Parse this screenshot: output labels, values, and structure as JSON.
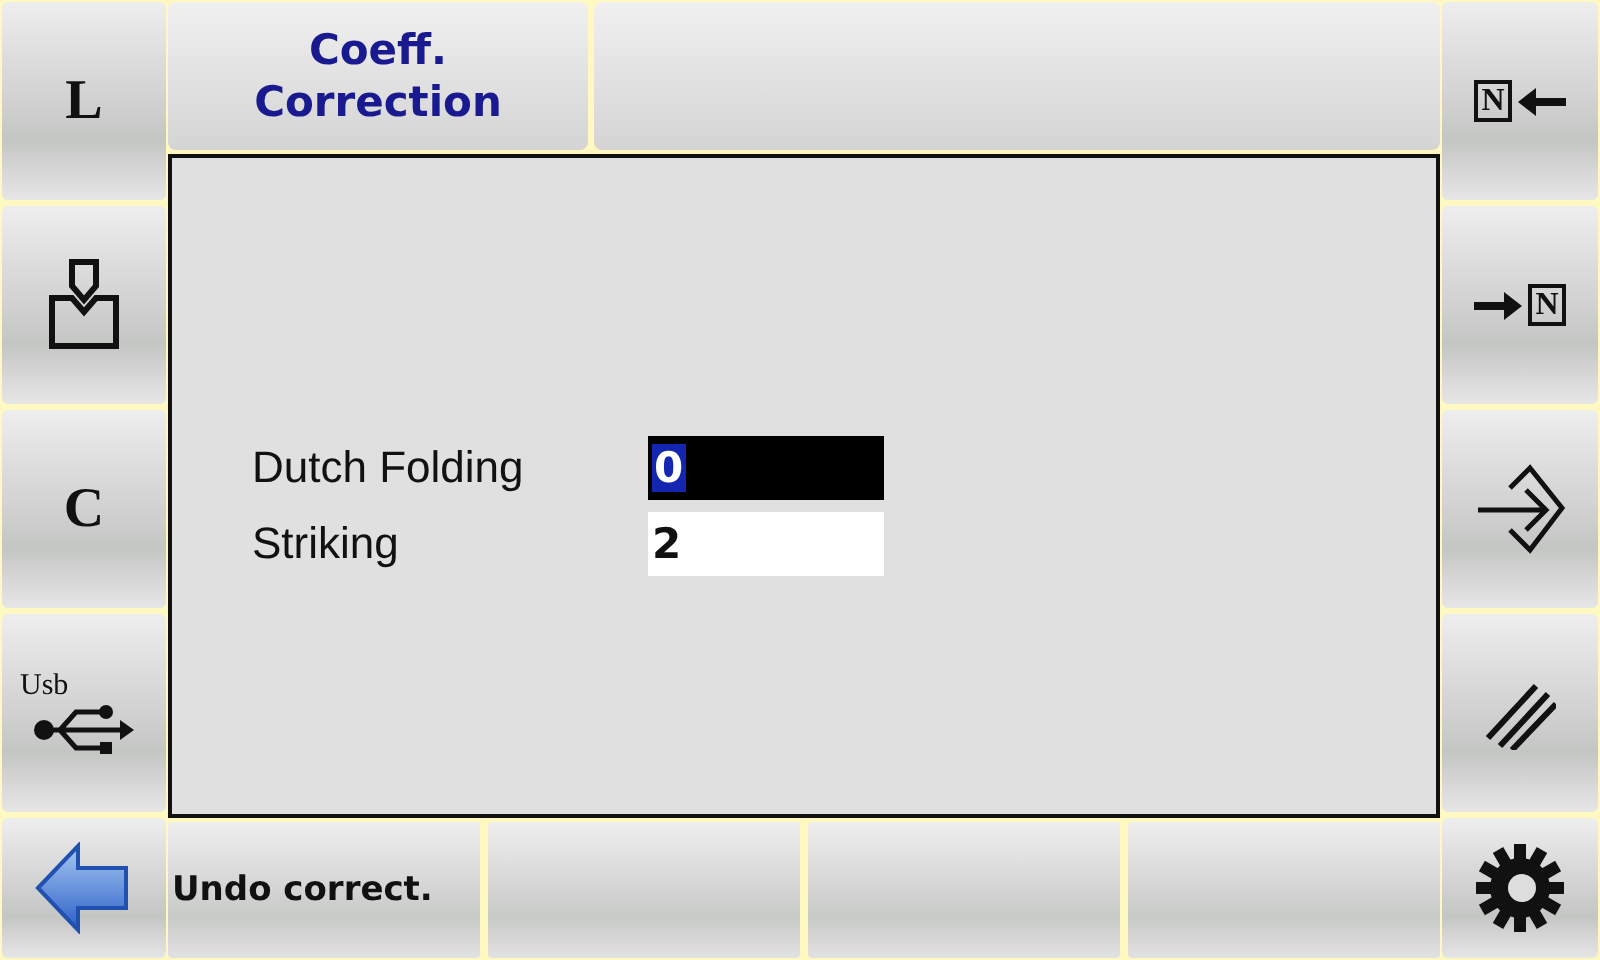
{
  "left_buttons": [
    {
      "kind": "letter",
      "label": "L"
    },
    {
      "kind": "punch"
    },
    {
      "kind": "letter",
      "label": "C"
    },
    {
      "kind": "usb",
      "label": "Usb"
    },
    {
      "kind": "back"
    }
  ],
  "top_tabs": [
    {
      "kind": "labelled",
      "label": "Coeff.\nCorrection"
    },
    {
      "kind": "blank"
    }
  ],
  "fields": [
    {
      "label": "Dutch Folding",
      "value": "0",
      "selected": true
    },
    {
      "label": "Striking",
      "value": "2",
      "selected": false
    }
  ],
  "bottom_buttons": [
    {
      "kind": "labelled",
      "label": "Undo correct."
    },
    {
      "kind": "blank"
    },
    {
      "kind": "blank"
    },
    {
      "kind": "blank"
    }
  ],
  "right_buttons": [
    {
      "kind": "n-left",
      "label": "N"
    },
    {
      "kind": "n-right",
      "label": "N"
    },
    {
      "kind": "enter"
    },
    {
      "kind": "slashes"
    },
    {
      "kind": "gear"
    }
  ]
}
